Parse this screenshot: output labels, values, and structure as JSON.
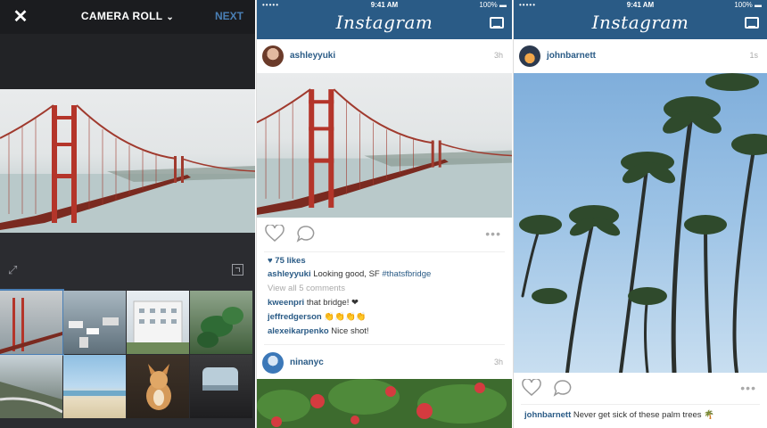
{
  "camera_roll": {
    "title": "CAMERA ROLL",
    "next_label": "NEXT",
    "close_icon": "close-icon",
    "chevron_icon": "chevron-down-icon",
    "expand_icon": "expand-icon",
    "layout_icon": "layout-icon",
    "thumbnails": [
      "golden-gate-bridge",
      "harbor-boats",
      "white-building",
      "plant",
      "coastal-road",
      "beach",
      "dog",
      "window-view"
    ]
  },
  "status_bar": {
    "carrier": "•••••",
    "time": "9:41 AM",
    "battery": "100% ▬"
  },
  "feed": {
    "app_name": "Instagram",
    "inbox_icon": "inbox-icon",
    "colors": {
      "header": "#2a5b86",
      "link": "#2a5b86"
    }
  },
  "post1": {
    "username": "ashleyyuki",
    "time": "3h",
    "likes": "♥ 75 likes",
    "caption_user": "ashleyyuki",
    "caption_text": " Looking good, SF ",
    "caption_tag": "#thatsfbridge",
    "view_all": "View all 5 comments",
    "comments": [
      {
        "user": "kweenpri",
        "text": " that bridge! ❤"
      },
      {
        "user": "jeffredgerson",
        "text": " 👏👏👏👏"
      },
      {
        "user": "alexeikarpenko",
        "text": " Nice shot!"
      }
    ]
  },
  "post2": {
    "username": "ninanyc",
    "time": "3h"
  },
  "post3": {
    "username": "johnbarnett",
    "time": "1s",
    "caption_user": "johnbarnett",
    "caption_text": " Never get sick of these palm trees 🌴"
  }
}
